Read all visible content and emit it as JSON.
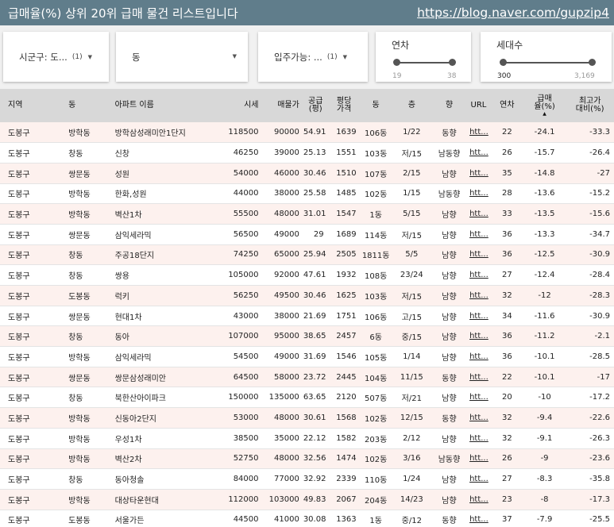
{
  "header": {
    "title": "급매율(%) 상위 20위 급매 물건 리스트입니다",
    "link": "https://blog.naver.com/gupzip4",
    "bg_color": "#607d8b"
  },
  "filters": {
    "sigungu": {
      "label": "시군구: 도...",
      "count": "(1)"
    },
    "dong": {
      "label": "동"
    },
    "move_in": {
      "label": "입주가능: ...",
      "count": "(1)"
    },
    "age": {
      "label": "연차",
      "min": "19",
      "max": "38"
    },
    "households": {
      "label": "세대수",
      "min": "300",
      "max": "3,169"
    }
  },
  "table": {
    "columns": [
      "지역",
      "동",
      "아파트 이름",
      "시세",
      "매물가",
      "공급\n(평)",
      "평당\n가격",
      "동",
      "층",
      "향",
      "URL",
      "연차",
      "급매\n율(%)",
      "최고가\n대비(%)"
    ],
    "sort_column": "급매율(%)",
    "row_tint": "#fdf1ee",
    "rows": [
      [
        "도봉구",
        "방학동",
        "방학삼성래미안1단지",
        "118500",
        "90000",
        "54.91",
        "1639",
        "106동",
        "1/22",
        "동향",
        "htt...",
        "22",
        "-24.1",
        "-33.3"
      ],
      [
        "도봉구",
        "창동",
        "신창",
        "46250",
        "39000",
        "25.13",
        "1551",
        "103동",
        "저/15",
        "남동향",
        "htt...",
        "26",
        "-15.7",
        "-26.4"
      ],
      [
        "도봉구",
        "쌍문동",
        "성원",
        "54000",
        "46000",
        "30.46",
        "1510",
        "107동",
        "2/15",
        "남향",
        "htt...",
        "35",
        "-14.8",
        "-27"
      ],
      [
        "도봉구",
        "방학동",
        "한화,성원",
        "44000",
        "38000",
        "25.58",
        "1485",
        "102동",
        "1/15",
        "남동향",
        "htt...",
        "28",
        "-13.6",
        "-15.2"
      ],
      [
        "도봉구",
        "방학동",
        "벽산1차",
        "55500",
        "48000",
        "31.01",
        "1547",
        "1동",
        "5/15",
        "남향",
        "htt...",
        "33",
        "-13.5",
        "-15.6"
      ],
      [
        "도봉구",
        "쌍문동",
        "삼익세라믹",
        "56500",
        "49000",
        "29",
        "1689",
        "114동",
        "저/15",
        "남향",
        "htt...",
        "36",
        "-13.3",
        "-34.7"
      ],
      [
        "도봉구",
        "창동",
        "주공18단지",
        "74250",
        "65000",
        "25.94",
        "2505",
        "1811동",
        "5/5",
        "남향",
        "htt...",
        "36",
        "-12.5",
        "-30.9"
      ],
      [
        "도봉구",
        "창동",
        "쌍용",
        "105000",
        "92000",
        "47.61",
        "1932",
        "108동",
        "23/24",
        "남향",
        "htt...",
        "27",
        "-12.4",
        "-28.4"
      ],
      [
        "도봉구",
        "도봉동",
        "럭키",
        "56250",
        "49500",
        "30.46",
        "1625",
        "103동",
        "저/15",
        "남향",
        "htt...",
        "32",
        "-12",
        "-28.3"
      ],
      [
        "도봉구",
        "쌍문동",
        "현대1차",
        "43000",
        "38000",
        "21.69",
        "1751",
        "106동",
        "고/15",
        "남향",
        "htt...",
        "34",
        "-11.6",
        "-30.9"
      ],
      [
        "도봉구",
        "창동",
        "동아",
        "107000",
        "95000",
        "38.65",
        "2457",
        "6동",
        "중/15",
        "남향",
        "htt...",
        "36",
        "-11.2",
        "-2.1"
      ],
      [
        "도봉구",
        "방학동",
        "삼익세라믹",
        "54500",
        "49000",
        "31.69",
        "1546",
        "105동",
        "1/14",
        "남향",
        "htt...",
        "36",
        "-10.1",
        "-28.5"
      ],
      [
        "도봉구",
        "쌍문동",
        "쌍문삼성래미안",
        "64500",
        "58000",
        "23.72",
        "2445",
        "104동",
        "11/15",
        "동향",
        "htt...",
        "22",
        "-10.1",
        "-17"
      ],
      [
        "도봉구",
        "창동",
        "북한산아이파크",
        "150000",
        "135000",
        "63.65",
        "2120",
        "507동",
        "저/21",
        "남향",
        "htt...",
        "20",
        "-10",
        "-17.2"
      ],
      [
        "도봉구",
        "방학동",
        "신동아2단지",
        "53000",
        "48000",
        "30.61",
        "1568",
        "102동",
        "12/15",
        "동향",
        "htt...",
        "32",
        "-9.4",
        "-22.6"
      ],
      [
        "도봉구",
        "방학동",
        "우성1차",
        "38500",
        "35000",
        "22.12",
        "1582",
        "203동",
        "2/12",
        "남향",
        "htt...",
        "32",
        "-9.1",
        "-26.3"
      ],
      [
        "도봉구",
        "방학동",
        "벽산2차",
        "52750",
        "48000",
        "32.56",
        "1474",
        "102동",
        "3/16",
        "남동향",
        "htt...",
        "26",
        "-9",
        "-23.6"
      ],
      [
        "도봉구",
        "창동",
        "동아청솔",
        "84000",
        "77000",
        "32.92",
        "2339",
        "110동",
        "1/24",
        "남향",
        "htt...",
        "27",
        "-8.3",
        "-35.8"
      ],
      [
        "도봉구",
        "방학동",
        "대상타운현대",
        "112000",
        "103000",
        "49.83",
        "2067",
        "204동",
        "14/23",
        "남향",
        "htt...",
        "23",
        "-8",
        "-17.3"
      ],
      [
        "도봉구",
        "도봉동",
        "서울가든",
        "44500",
        "41000",
        "30.08",
        "1363",
        "1동",
        "중/12",
        "동향",
        "htt...",
        "37",
        "-7.9",
        "-25.5"
      ]
    ]
  }
}
